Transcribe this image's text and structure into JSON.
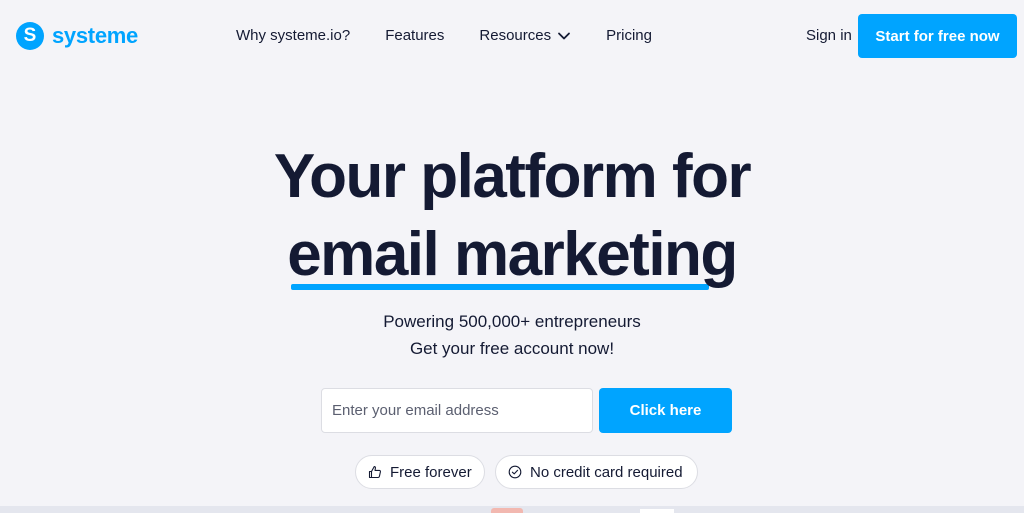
{
  "brand": {
    "logo_letter": "S",
    "name": "systeme",
    "color": "#00a4ff"
  },
  "nav": {
    "items": [
      {
        "label": "Why systeme.io?"
      },
      {
        "label": "Features"
      },
      {
        "label": "Resources",
        "icon": "chevron-down-icon"
      },
      {
        "label": "Pricing"
      }
    ],
    "sign_in": "Sign in",
    "cta": "Start for free now"
  },
  "hero": {
    "title_line1": "Your platform for",
    "title_highlight": "email marketing",
    "subtitle1": "Powering 500,000+ entrepreneurs",
    "subtitle2": "Get your free account now!"
  },
  "form": {
    "email_placeholder": "Enter your email address",
    "email_value": "",
    "submit_label": "Click here"
  },
  "badges": [
    {
      "icon": "thumbs-up-icon",
      "label": "Free forever"
    },
    {
      "icon": "check-circle-icon",
      "label": "No credit card required"
    }
  ],
  "colors": {
    "accent": "#00a4ff",
    "text": "#141a33",
    "background": "#f4f4f8"
  }
}
